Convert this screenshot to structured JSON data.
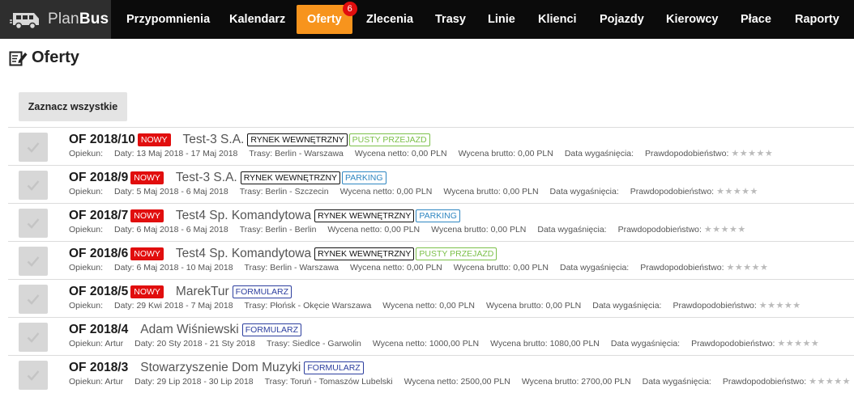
{
  "app": {
    "name_regular": "Plan",
    "name_bold": "Bus"
  },
  "nav": [
    {
      "label": "Przypomnienia",
      "active": false
    },
    {
      "label": "Kalendarz",
      "active": false
    },
    {
      "label": "Oferty",
      "active": true,
      "badge": "6"
    },
    {
      "label": "Zlecenia",
      "active": false
    },
    {
      "label": "Trasy",
      "active": false
    },
    {
      "label": "Linie",
      "active": false
    },
    {
      "label": "Klienci",
      "active": false
    },
    {
      "label": "Pojazdy",
      "active": false
    },
    {
      "label": "Kierowcy",
      "active": false
    },
    {
      "label": "Płace",
      "active": false
    },
    {
      "label": "Raporty",
      "active": false
    }
  ],
  "page": {
    "title": "Oferty",
    "select_all_label": "Zaznacz wszystkie"
  },
  "colors": {
    "navbar": "#0b0b0b",
    "brand_bg": "#2e2e2e",
    "active_tab": "#f7941d",
    "badge": "#e10e0e",
    "tag_new": "#e10e0e",
    "tag_empty": "#7cc04a",
    "tag_parking": "#2e86c1",
    "tag_form": "#2c3e9e"
  },
  "offers": [
    {
      "number": "OF 2018/10",
      "new_label": "NOWY",
      "client": "Test-3 S.A.",
      "tags": [
        {
          "text": "RYNEK WEWNĘTRZNY",
          "type": "market"
        },
        {
          "text": "PUSTY PRZEJAZD",
          "type": "empty"
        }
      ],
      "opiekun": "Opiekun:",
      "dates": "Daty: 13 Maj 2018 - 17 Maj 2018",
      "routes": "Trasy: Berlin - Warszawa",
      "netto": "Wycena netto: 0,00 PLN",
      "brutto": "Wycena brutto: 0,00 PLN",
      "expiry": "Data wygaśnięcia:",
      "probability": "Prawdopodobieństwo:",
      "stars": "★★★★★"
    },
    {
      "number": "OF 2018/9",
      "new_label": "NOWY",
      "client": "Test-3 S.A.",
      "tags": [
        {
          "text": "RYNEK WEWNĘTRZNY",
          "type": "market"
        },
        {
          "text": "PARKING",
          "type": "parking"
        }
      ],
      "opiekun": "Opiekun:",
      "dates": "Daty: 5 Maj 2018 - 6 Maj 2018",
      "routes": "Trasy: Berlin - Szczecin",
      "netto": "Wycena netto: 0,00 PLN",
      "brutto": "Wycena brutto: 0,00 PLN",
      "expiry": "Data wygaśnięcia:",
      "probability": "Prawdopodobieństwo:",
      "stars": "★★★★★"
    },
    {
      "number": "OF 2018/7",
      "new_label": "NOWY",
      "client": "Test4 Sp. Komandytowa",
      "tags": [
        {
          "text": "RYNEK WEWNĘTRZNY",
          "type": "market"
        },
        {
          "text": "PARKING",
          "type": "parking"
        }
      ],
      "opiekun": "Opiekun:",
      "dates": "Daty: 6 Maj 2018 - 6 Maj 2018",
      "routes": "Trasy: Berlin - Berlin",
      "netto": "Wycena netto: 0,00 PLN",
      "brutto": "Wycena brutto: 0,00 PLN",
      "expiry": "Data wygaśnięcia:",
      "probability": "Prawdopodobieństwo:",
      "stars": "★★★★★"
    },
    {
      "number": "OF 2018/6",
      "new_label": "NOWY",
      "client": "Test4 Sp. Komandytowa",
      "tags": [
        {
          "text": "RYNEK WEWNĘTRZNY",
          "type": "market"
        },
        {
          "text": "PUSTY PRZEJAZD",
          "type": "empty"
        }
      ],
      "opiekun": "Opiekun:",
      "dates": "Daty: 6 Maj 2018 - 10 Maj 2018",
      "routes": "Trasy: Berlin - Warszawa",
      "netto": "Wycena netto: 0,00 PLN",
      "brutto": "Wycena brutto: 0,00 PLN",
      "expiry": "Data wygaśnięcia:",
      "probability": "Prawdopodobieństwo:",
      "stars": "★★★★★"
    },
    {
      "number": "OF 2018/5",
      "new_label": "NOWY",
      "client": "MarekTur",
      "tags": [
        {
          "text": "FORMULARZ",
          "type": "form"
        }
      ],
      "opiekun": "Opiekun:",
      "dates": "Daty: 29 Kwi 2018 - 7 Maj 2018",
      "routes": "Trasy: Płońsk - Okęcie Warszawa",
      "netto": "Wycena netto: 0,00 PLN",
      "brutto": "Wycena brutto: 0,00 PLN",
      "expiry": "Data wygaśnięcia:",
      "probability": "Prawdopodobieństwo:",
      "stars": "★★★★★"
    },
    {
      "number": "OF 2018/4",
      "new_label": "",
      "client": "Adam Wiśniewski",
      "tags": [
        {
          "text": "FORMULARZ",
          "type": "form"
        }
      ],
      "opiekun": "Opiekun: Artur",
      "dates": "Daty: 20 Sty 2018 - 21 Sty 2018",
      "routes": "Trasy: Siedlce - Garwolin",
      "netto": "Wycena netto: 1000,00 PLN",
      "brutto": "Wycena brutto: 1080,00 PLN",
      "expiry": "Data wygaśnięcia:",
      "probability": "Prawdopodobieństwo:",
      "stars": "★★★★★"
    },
    {
      "number": "OF 2018/3",
      "new_label": "",
      "client": "Stowarzyszenie Dom Muzyki",
      "tags": [
        {
          "text": "FORMULARZ",
          "type": "form"
        }
      ],
      "opiekun": "Opiekun: Artur",
      "dates": "Daty: 29 Lip 2018 - 30 Lip 2018",
      "routes": "Trasy: Toruń - Tomaszów Lubelski",
      "netto": "Wycena netto: 2500,00 PLN",
      "brutto": "Wycena brutto: 2700,00 PLN",
      "expiry": "Data wygaśnięcia:",
      "probability": "Prawdopodobieństwo:",
      "stars": "★★★★★"
    }
  ]
}
